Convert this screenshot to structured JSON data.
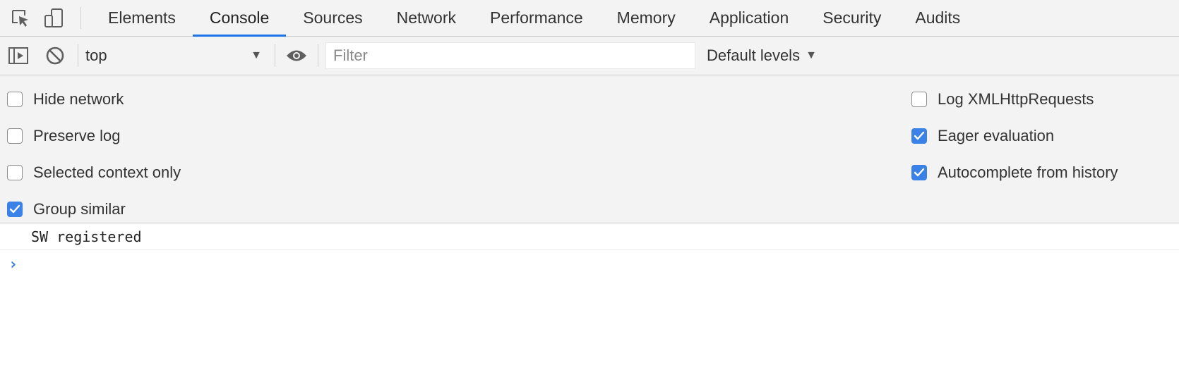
{
  "tabs": [
    {
      "label": "Elements",
      "active": false
    },
    {
      "label": "Console",
      "active": true
    },
    {
      "label": "Sources",
      "active": false
    },
    {
      "label": "Network",
      "active": false
    },
    {
      "label": "Performance",
      "active": false
    },
    {
      "label": "Memory",
      "active": false
    },
    {
      "label": "Application",
      "active": false
    },
    {
      "label": "Security",
      "active": false
    },
    {
      "label": "Audits",
      "active": false
    }
  ],
  "icons": {
    "inspect": "inspect-element-icon",
    "device": "device-toolbar-icon",
    "sidebar": "show-sidebar-icon",
    "clear": "clear-console-icon",
    "eye": "live-expression-icon",
    "dropdown": "dropdown-arrow-icon",
    "prompt": "console-prompt-icon"
  },
  "toolbar": {
    "context_value": "top",
    "filter_placeholder": "Filter",
    "filter_value": "",
    "levels_label": "Default levels"
  },
  "settings": {
    "left": [
      {
        "label": "Hide network",
        "checked": false
      },
      {
        "label": "Preserve log",
        "checked": false
      },
      {
        "label": "Selected context only",
        "checked": false
      },
      {
        "label": "Group similar",
        "checked": true
      }
    ],
    "right": [
      {
        "label": "Log XMLHttpRequests",
        "checked": false
      },
      {
        "label": "Eager evaluation",
        "checked": true
      },
      {
        "label": "Autocomplete from history",
        "checked": true
      }
    ]
  },
  "console": {
    "messages": [
      "SW registered"
    ],
    "prompt_glyph": "›"
  },
  "colors": {
    "accent": "#1a73e8",
    "checkbox_checked": "#3a82e8",
    "prompt": "#2f7ae5"
  }
}
